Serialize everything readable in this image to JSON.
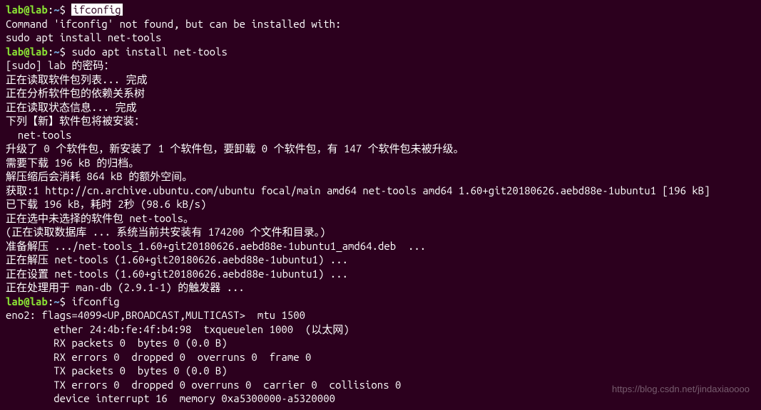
{
  "prompt": {
    "user": "lab@lab",
    "sep1": ":",
    "path": "~",
    "sep2": "$ "
  },
  "lines": {
    "cmd1": "ifconfig",
    "blank": "",
    "out1": "Command 'ifconfig' not found, but can be installed with:",
    "out2": "sudo apt install net-tools",
    "cmd2": "sudo apt install net-tools",
    "l01": "[sudo] lab 的密码：",
    "l02": "正在读取软件包列表... 完成",
    "l03": "正在分析软件包的依赖关系树",
    "l04": "正在读取状态信息... 完成",
    "l05": "下列【新】软件包将被安装：",
    "l06": "  net-tools",
    "l07": "升级了 0 个软件包，新安装了 1 个软件包，要卸载 0 个软件包，有 147 个软件包未被升级。",
    "l08": "需要下载 196 kB 的归档。",
    "l09": "解压缩后会消耗 864 kB 的额外空间。",
    "l10": "获取:1 http://cn.archive.ubuntu.com/ubuntu focal/main amd64 net-tools amd64 1.60+git20180626.aebd88e-1ubuntu1 [196 kB]",
    "l11": "已下载 196 kB，耗时 2秒 (98.6 kB/s)",
    "l12": "正在选中未选择的软件包 net-tools。",
    "l13": "(正在读取数据库 ... 系统当前共安装有 174200 个文件和目录。)",
    "l14": "准备解压 .../net-tools_1.60+git20180626.aebd88e-1ubuntu1_amd64.deb  ...",
    "l15": "正在解压 net-tools (1.60+git20180626.aebd88e-1ubuntu1) ...",
    "l16": "正在设置 net-tools (1.60+git20180626.aebd88e-1ubuntu1) ...",
    "l17": "正在处理用于 man-db (2.9.1-1) 的触发器 ...",
    "cmd3": "ifconfig",
    "if1": "eno2: flags=4099<UP,BROADCAST,MULTICAST>  mtu 1500",
    "if2": "        ether 24:4b:fe:4f:b4:98  txqueuelen 1000  (以太网)",
    "if3": "        RX packets 0  bytes 0 (0.0 B)",
    "if4": "        RX errors 0  dropped 0  overruns 0  frame 0",
    "if5": "        TX packets 0  bytes 0 (0.0 B)",
    "if6": "        TX errors 0  dropped 0 overruns 0  carrier 0  collisions 0",
    "if7": "        device interrupt 16  memory 0xa5300000-a5320000"
  },
  "watermark": "https://blog.csdn.net/jindaxiaoooo"
}
